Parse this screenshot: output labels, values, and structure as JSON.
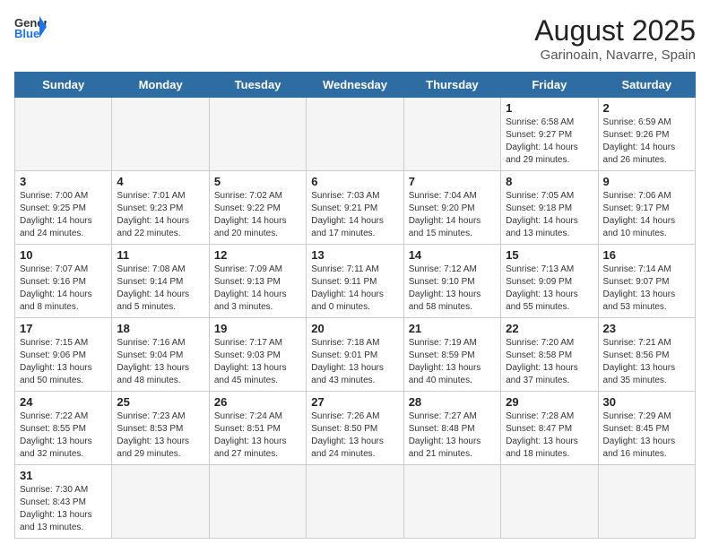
{
  "header": {
    "logo_general": "General",
    "logo_blue": "Blue",
    "title": "August 2025",
    "subtitle": "Garinoain, Navarre, Spain"
  },
  "days_of_week": [
    "Sunday",
    "Monday",
    "Tuesday",
    "Wednesday",
    "Thursday",
    "Friday",
    "Saturday"
  ],
  "weeks": [
    [
      {
        "day": "",
        "info": ""
      },
      {
        "day": "",
        "info": ""
      },
      {
        "day": "",
        "info": ""
      },
      {
        "day": "",
        "info": ""
      },
      {
        "day": "",
        "info": ""
      },
      {
        "day": "1",
        "info": "Sunrise: 6:58 AM\nSunset: 9:27 PM\nDaylight: 14 hours and 29 minutes."
      },
      {
        "day": "2",
        "info": "Sunrise: 6:59 AM\nSunset: 9:26 PM\nDaylight: 14 hours and 26 minutes."
      }
    ],
    [
      {
        "day": "3",
        "info": "Sunrise: 7:00 AM\nSunset: 9:25 PM\nDaylight: 14 hours and 24 minutes."
      },
      {
        "day": "4",
        "info": "Sunrise: 7:01 AM\nSunset: 9:23 PM\nDaylight: 14 hours and 22 minutes."
      },
      {
        "day": "5",
        "info": "Sunrise: 7:02 AM\nSunset: 9:22 PM\nDaylight: 14 hours and 20 minutes."
      },
      {
        "day": "6",
        "info": "Sunrise: 7:03 AM\nSunset: 9:21 PM\nDaylight: 14 hours and 17 minutes."
      },
      {
        "day": "7",
        "info": "Sunrise: 7:04 AM\nSunset: 9:20 PM\nDaylight: 14 hours and 15 minutes."
      },
      {
        "day": "8",
        "info": "Sunrise: 7:05 AM\nSunset: 9:18 PM\nDaylight: 14 hours and 13 minutes."
      },
      {
        "day": "9",
        "info": "Sunrise: 7:06 AM\nSunset: 9:17 PM\nDaylight: 14 hours and 10 minutes."
      }
    ],
    [
      {
        "day": "10",
        "info": "Sunrise: 7:07 AM\nSunset: 9:16 PM\nDaylight: 14 hours and 8 minutes."
      },
      {
        "day": "11",
        "info": "Sunrise: 7:08 AM\nSunset: 9:14 PM\nDaylight: 14 hours and 5 minutes."
      },
      {
        "day": "12",
        "info": "Sunrise: 7:09 AM\nSunset: 9:13 PM\nDaylight: 14 hours and 3 minutes."
      },
      {
        "day": "13",
        "info": "Sunrise: 7:11 AM\nSunset: 9:11 PM\nDaylight: 14 hours and 0 minutes."
      },
      {
        "day": "14",
        "info": "Sunrise: 7:12 AM\nSunset: 9:10 PM\nDaylight: 13 hours and 58 minutes."
      },
      {
        "day": "15",
        "info": "Sunrise: 7:13 AM\nSunset: 9:09 PM\nDaylight: 13 hours and 55 minutes."
      },
      {
        "day": "16",
        "info": "Sunrise: 7:14 AM\nSunset: 9:07 PM\nDaylight: 13 hours and 53 minutes."
      }
    ],
    [
      {
        "day": "17",
        "info": "Sunrise: 7:15 AM\nSunset: 9:06 PM\nDaylight: 13 hours and 50 minutes."
      },
      {
        "day": "18",
        "info": "Sunrise: 7:16 AM\nSunset: 9:04 PM\nDaylight: 13 hours and 48 minutes."
      },
      {
        "day": "19",
        "info": "Sunrise: 7:17 AM\nSunset: 9:03 PM\nDaylight: 13 hours and 45 minutes."
      },
      {
        "day": "20",
        "info": "Sunrise: 7:18 AM\nSunset: 9:01 PM\nDaylight: 13 hours and 43 minutes."
      },
      {
        "day": "21",
        "info": "Sunrise: 7:19 AM\nSunset: 8:59 PM\nDaylight: 13 hours and 40 minutes."
      },
      {
        "day": "22",
        "info": "Sunrise: 7:20 AM\nSunset: 8:58 PM\nDaylight: 13 hours and 37 minutes."
      },
      {
        "day": "23",
        "info": "Sunrise: 7:21 AM\nSunset: 8:56 PM\nDaylight: 13 hours and 35 minutes."
      }
    ],
    [
      {
        "day": "24",
        "info": "Sunrise: 7:22 AM\nSunset: 8:55 PM\nDaylight: 13 hours and 32 minutes."
      },
      {
        "day": "25",
        "info": "Sunrise: 7:23 AM\nSunset: 8:53 PM\nDaylight: 13 hours and 29 minutes."
      },
      {
        "day": "26",
        "info": "Sunrise: 7:24 AM\nSunset: 8:51 PM\nDaylight: 13 hours and 27 minutes."
      },
      {
        "day": "27",
        "info": "Sunrise: 7:26 AM\nSunset: 8:50 PM\nDaylight: 13 hours and 24 minutes."
      },
      {
        "day": "28",
        "info": "Sunrise: 7:27 AM\nSunset: 8:48 PM\nDaylight: 13 hours and 21 minutes."
      },
      {
        "day": "29",
        "info": "Sunrise: 7:28 AM\nSunset: 8:47 PM\nDaylight: 13 hours and 18 minutes."
      },
      {
        "day": "30",
        "info": "Sunrise: 7:29 AM\nSunset: 8:45 PM\nDaylight: 13 hours and 16 minutes."
      }
    ],
    [
      {
        "day": "31",
        "info": "Sunrise: 7:30 AM\nSunset: 8:43 PM\nDaylight: 13 hours and 13 minutes."
      },
      {
        "day": "",
        "info": ""
      },
      {
        "day": "",
        "info": ""
      },
      {
        "day": "",
        "info": ""
      },
      {
        "day": "",
        "info": ""
      },
      {
        "day": "",
        "info": ""
      },
      {
        "day": "",
        "info": ""
      }
    ]
  ]
}
